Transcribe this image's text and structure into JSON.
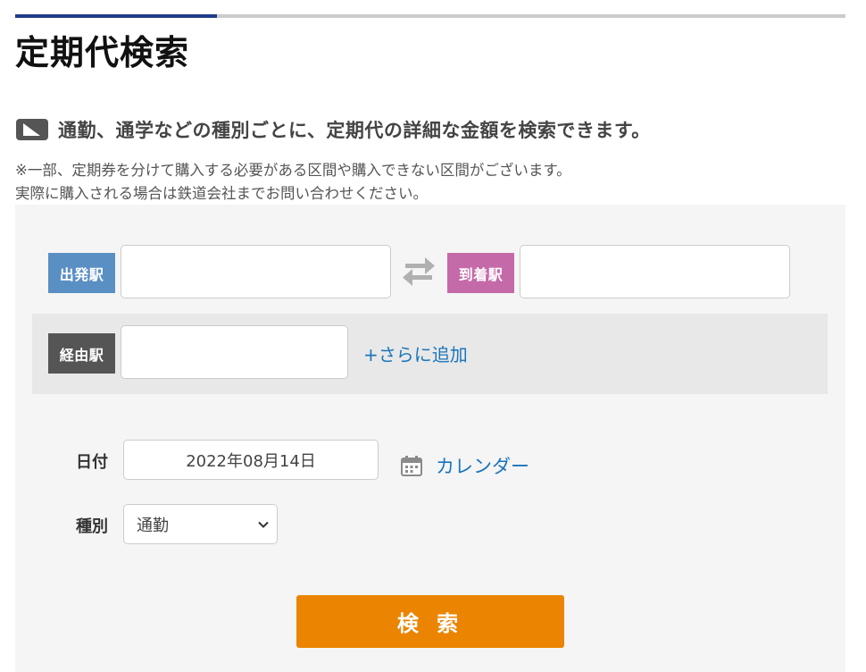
{
  "page": {
    "title": "定期代検索",
    "lead": "通勤、通学などの種別ごとに、定期代の詳細な金額を検索できます。",
    "notes": [
      "※一部、定期券を分けて購入する必要がある区間や購入できない区間がございます。",
      "実際に購入される場合は鉄道会社までお問い合わせください。"
    ]
  },
  "form": {
    "from": {
      "label": "出発駅",
      "value": ""
    },
    "to": {
      "label": "到着駅",
      "value": ""
    },
    "via": {
      "label": "経由駅",
      "value": "",
      "add_link": "+さらに追加"
    },
    "date": {
      "label": "日付",
      "value": "2022年08月14日",
      "calendar_link": "カレンダー"
    },
    "type": {
      "label": "種別",
      "selected": "通勤"
    },
    "search_button": "検 索"
  },
  "icons": {
    "lead": "rail-pass-icon",
    "swap": "swap-arrows-icon",
    "calendar": "calendar-icon",
    "dropdown": "chevron-down-icon"
  },
  "colors": {
    "from_label": "#5a8fc4",
    "to_label": "#c56aa8",
    "via_label": "#555555",
    "link": "#1a75bb",
    "search_button": "#eb8400",
    "title_accent": "#1f3c88"
  }
}
